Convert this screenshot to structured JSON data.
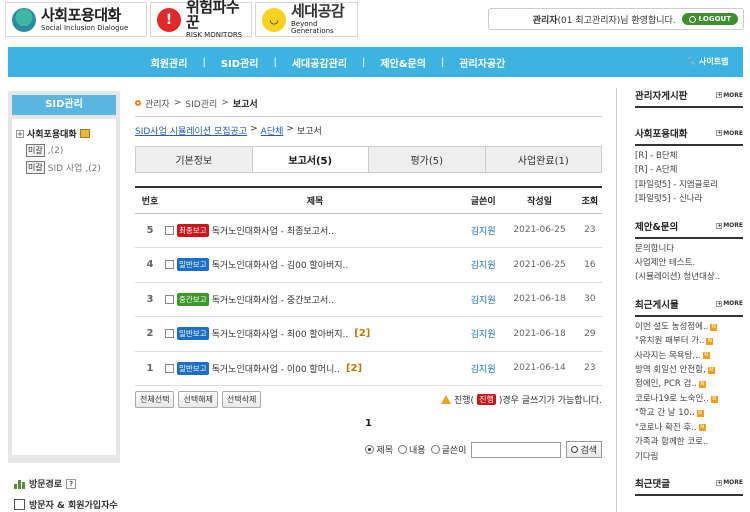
{
  "header": {
    "logos": [
      {
        "title": "사회포용대화",
        "subtitle": "Social Inclusion Dialogue"
      },
      {
        "title": "위험파수꾼",
        "subtitle": "RISK MONITORS"
      },
      {
        "title": "세대공감",
        "subtitle": "Beyond Generations"
      }
    ],
    "user_greeting_name": "관리자",
    "user_greeting_rest": "(01 최고관리자)님 환영합니다.",
    "logout_label": "LOGOUT"
  },
  "nav": {
    "items": [
      "회원관리",
      "SID관리",
      "세대공감관리",
      "제안&문의",
      "관리자공간"
    ],
    "separator": "|",
    "sitemap_label": "사이트맵",
    "bg_color": "#3cb3e0"
  },
  "sidebar": {
    "title": "SID관리",
    "root_label": "사회포용대화",
    "children": [
      {
        "tag": "미갈",
        "label": ",(2)"
      },
      {
        "tag": "미갈",
        "label": "SID 사업 ,(2)"
      }
    ],
    "links": [
      {
        "label": "방문경로",
        "help": "?"
      },
      {
        "label": "방문자 & 회원가입자수"
      }
    ]
  },
  "main": {
    "breadcrumb": [
      "관리자",
      "SID관리",
      "보고서"
    ],
    "breadcrumb_sep": ">",
    "path_links": [
      "SID사업 시뮬레이션 모집공고",
      "A단체"
    ],
    "path_current": "보고서",
    "tabs": [
      {
        "label": "기본정보",
        "active": false
      },
      {
        "label": "보고서(5)",
        "active": true
      },
      {
        "label": "평가(5)",
        "active": false
      },
      {
        "label": "사업완료(1)",
        "active": false
      }
    ],
    "table": {
      "headers": [
        "번호",
        "제목",
        "글쓴이",
        "작성일",
        "조회"
      ],
      "rows": [
        {
          "num": "5",
          "badge": "최종보고",
          "badge_type": "final",
          "subject": "독거노인대화사업 - 최종보고서..",
          "comments": "",
          "writer": "김지원",
          "date": "2021-06-25",
          "views": "23"
        },
        {
          "num": "4",
          "badge": "일반보고",
          "badge_type": "normal",
          "subject": "독거노인대화사업 - 김00 할아버지..",
          "comments": "",
          "writer": "김지원",
          "date": "2021-06-25",
          "views": "16"
        },
        {
          "num": "3",
          "badge": "중간보고",
          "badge_type": "mid",
          "subject": "독거노인대화사업 - 중간보고서..",
          "comments": "",
          "writer": "김지원",
          "date": "2021-06-18",
          "views": "30"
        },
        {
          "num": "2",
          "badge": "일반보고",
          "badge_type": "normal",
          "subject": "독거노인대화사업 - 최00 할아버지..",
          "comments": "[2]",
          "writer": "김지원",
          "date": "2021-06-18",
          "views": "29"
        },
        {
          "num": "1",
          "badge": "일반보고",
          "badge_type": "normal",
          "subject": "독거노인대화사업 - 이00 할머니..",
          "comments": "[2]",
          "writer": "김지원",
          "date": "2021-06-14",
          "views": "23"
        }
      ]
    },
    "buttons": [
      "전체선택",
      "선택해제",
      "선택삭제"
    ],
    "notice_pre": "진행(",
    "notice_badge": "진행",
    "notice_post": ")경우 글쓰기가 가능합니다.",
    "pagination": "1",
    "search": {
      "options": [
        {
          "label": "제목",
          "checked": true
        },
        {
          "label": "내용",
          "checked": false
        },
        {
          "label": "글쓴이",
          "checked": false
        }
      ],
      "input_value": "",
      "button_label": "검색"
    }
  },
  "right_sidebar": {
    "more_label": "MORE",
    "sections": [
      {
        "title": "관리자게시판",
        "items": []
      },
      {
        "title": "사회포용대화",
        "items": [
          {
            "text": "[R] - B단체",
            "new": false
          },
          {
            "text": "[R] - A단체",
            "new": false
          },
          {
            "text": "[파일럿5] - 지엠글로리",
            "new": false
          },
          {
            "text": "[파일럿5] - 신나라",
            "new": false
          }
        ]
      },
      {
        "title": "제안&문의",
        "items": [
          {
            "text": "문의합니다",
            "new": false
          },
          {
            "text": "사업제안 테스트.",
            "new": false
          },
          {
            "text": "(시뮬레이션) 청년대상..",
            "new": false
          }
        ]
      },
      {
        "title": "최근게시물",
        "items": [
          {
            "text": "이번 설도 농성정에..",
            "new": true
          },
          {
            "text": "\"유치원 패부터 가..",
            "new": true
          },
          {
            "text": "사라지는 목욕탕,..",
            "new": true
          },
          {
            "text": "방역 회일선 안전함,",
            "new": true
          },
          {
            "text": "정에인, PCR 검..",
            "new": true
          },
          {
            "text": "코로나19로 노숙인..",
            "new": true
          },
          {
            "text": "\"학교 간 날 10..",
            "new": true
          },
          {
            "text": "\"코로나 확진 후..",
            "new": true
          },
          {
            "text": "가족과 함께한 코로..",
            "new": false
          },
          {
            "text": "기다림",
            "new": false
          }
        ]
      },
      {
        "title": "최근댓글",
        "items": []
      }
    ]
  }
}
